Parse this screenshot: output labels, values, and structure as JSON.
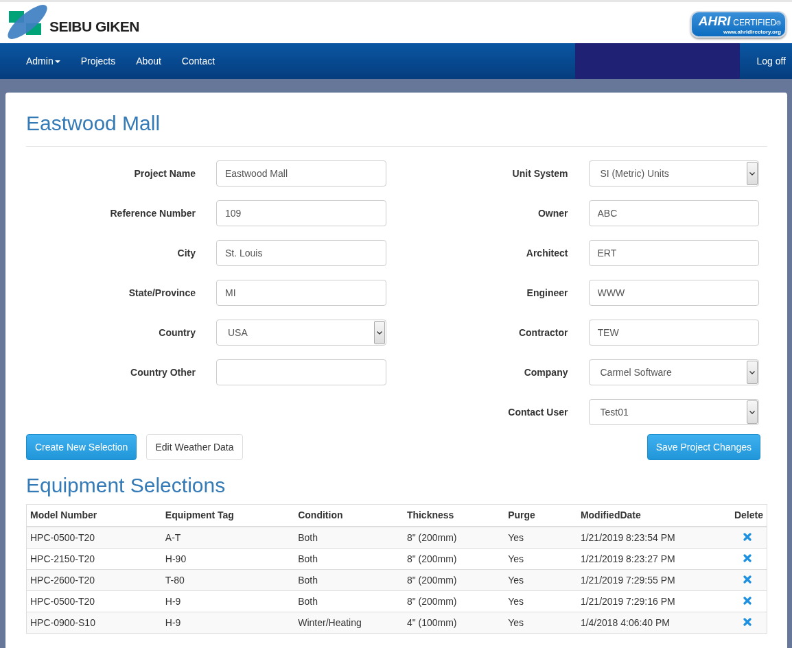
{
  "header": {
    "logo_text": "SEIBU GIKEN",
    "badge": {
      "main": "AHRI",
      "sub": "CERTIFIED",
      "mark": "®",
      "url": "www.ahridirectory.org"
    }
  },
  "nav": {
    "items": [
      {
        "label": "Admin",
        "dropdown": true
      },
      {
        "label": "Projects",
        "dropdown": false
      },
      {
        "label": "About",
        "dropdown": false
      },
      {
        "label": "Contact",
        "dropdown": false
      }
    ],
    "logoff": "Log off"
  },
  "page_title": "Eastwood Mall",
  "form": {
    "left": [
      {
        "label": "Project Name",
        "kind": "text",
        "value": "Eastwood Mall"
      },
      {
        "label": "Reference Number",
        "kind": "text",
        "value": "109"
      },
      {
        "label": "City",
        "kind": "text",
        "value": "St. Louis"
      },
      {
        "label": "State/Province",
        "kind": "text",
        "value": "MI"
      },
      {
        "label": "Country",
        "kind": "select",
        "value": "USA"
      },
      {
        "label": "Country Other",
        "kind": "text"
      }
    ],
    "right": [
      {
        "label": "Unit System",
        "kind": "select",
        "value": "SI (Metric) Units"
      },
      {
        "label": "Owner",
        "kind": "text",
        "value": "ABC"
      },
      {
        "label": "Architect",
        "kind": "text",
        "value": "ERT"
      },
      {
        "label": "Engineer",
        "kind": "text",
        "value": "WWW"
      },
      {
        "label": "Contractor",
        "kind": "text",
        "value": "TEW"
      },
      {
        "label": "Company",
        "kind": "select",
        "value": "Carmel Software"
      },
      {
        "label": "Contact User",
        "kind": "select",
        "value": "Test01"
      }
    ]
  },
  "buttons": {
    "create": "Create New Selection",
    "weather": "Edit Weather Data",
    "save": "Save Project Changes"
  },
  "section_title": "Equipment Selections",
  "table": {
    "columns": [
      "Model Number",
      "Equipment Tag",
      "Condition",
      "Thickness",
      "Purge",
      "ModifiedDate",
      "Delete"
    ],
    "rows": [
      [
        "HPC-0500-T20",
        "A-T",
        "Both",
        "8\" (200mm)",
        "Yes",
        "1/21/2019 8:23:54 PM"
      ],
      [
        "HPC-2150-T20",
        "H-90",
        "Both",
        "8\" (200mm)",
        "Yes",
        "1/21/2019 8:23:27 PM"
      ],
      [
        "HPC-2600-T20",
        "T-80",
        "Both",
        "8\" (200mm)",
        "Yes",
        "1/21/2019 7:29:55 PM"
      ],
      [
        "HPC-0500-T20",
        "H-9",
        "Both",
        "8\" (200mm)",
        "Yes",
        "1/21/2019 7:29:16 PM"
      ],
      [
        "HPC-0900-S10",
        "H-9",
        "Winter/Heating",
        "4\" (100mm)",
        "Yes",
        "1/4/2018 4:06:40 PM"
      ]
    ]
  }
}
